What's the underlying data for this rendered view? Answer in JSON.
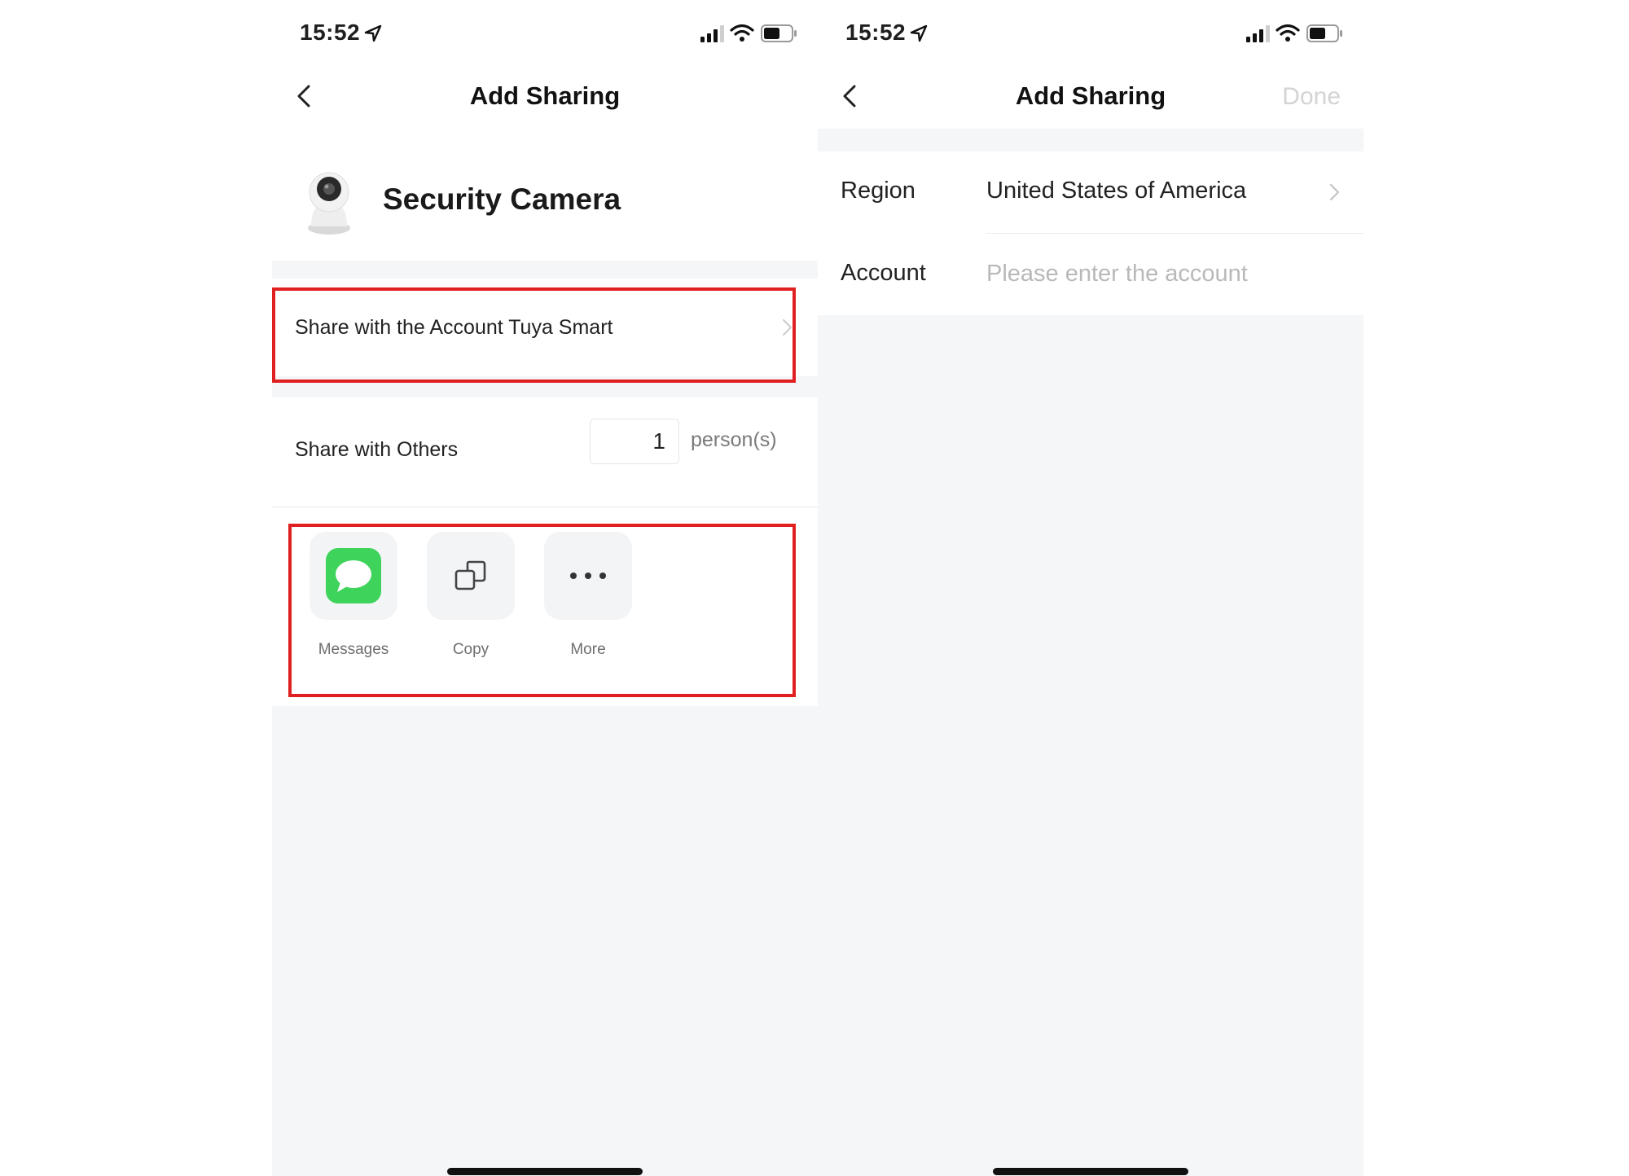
{
  "left_screen": {
    "status": {
      "time": "15:52"
    },
    "nav": {
      "title": "Add Sharing"
    },
    "device": {
      "name": "Security Camera"
    },
    "share_account": {
      "label": "Share with the Account Tuya Smart"
    },
    "share_others": {
      "label": "Share with Others",
      "count": "1",
      "unit": "person(s)"
    },
    "share_options": [
      {
        "label": "Messages",
        "icon": "messages-icon"
      },
      {
        "label": "Copy",
        "icon": "copy-icon"
      },
      {
        "label": "More",
        "icon": "more-icon"
      }
    ]
  },
  "right_screen": {
    "status": {
      "time": "15:52"
    },
    "nav": {
      "title": "Add Sharing",
      "done_label": "Done"
    },
    "region": {
      "label": "Region",
      "value": "United States of America"
    },
    "account": {
      "label": "Account",
      "placeholder": "Please enter the account",
      "value": ""
    }
  },
  "colors": {
    "highlight": "#e02020",
    "messages_green": "#3ed35a",
    "page_gray": "#f5f6f8",
    "done_disabled": "#d3d3d3"
  }
}
